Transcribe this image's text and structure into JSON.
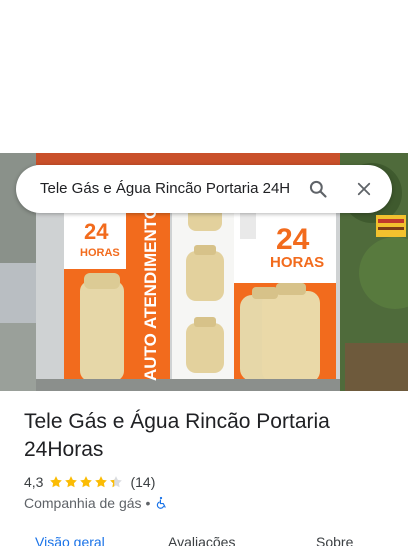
{
  "search": {
    "query": "Tele Gás e Água Rincão Portaria 24H"
  },
  "photo": {
    "signs": {
      "hours_left": "24",
      "hours_left_sub": "HORAS",
      "hours_right": "24",
      "hours_right_sub": "HORAS",
      "vertical": "AUTO ATENDIMENTO"
    }
  },
  "place": {
    "title": "Tele Gás e Água Rincão Portaria 24Horas",
    "rating": "4,3",
    "stars": 4.3,
    "reviews": "(14)",
    "category": "Companhia de gás",
    "separator": "•"
  },
  "tabs": [
    {
      "label": "Visão geral",
      "active": true
    },
    {
      "label": "Avaliações",
      "active": false
    },
    {
      "label": "Sobre",
      "active": false
    }
  ],
  "colors": {
    "accent": "#1a73e8",
    "star": "#fbbc04",
    "sign_orange": "#f26b1d"
  }
}
